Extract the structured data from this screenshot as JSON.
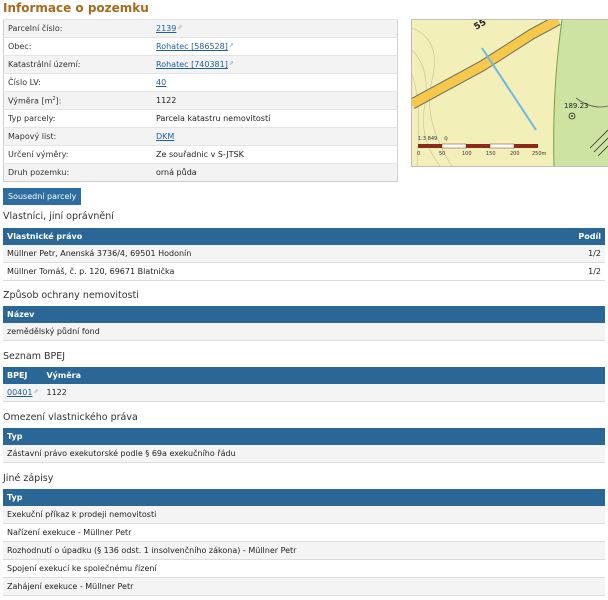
{
  "title": "Informace o pozemku",
  "info_rows": [
    {
      "label": "Parcelní číslo:",
      "value": "2139",
      "link": true
    },
    {
      "label": "Obec:",
      "value": "Rohatec [586528]",
      "link": true
    },
    {
      "label": "Katastrální území:",
      "value": "Rohatec [740381]",
      "link": true
    },
    {
      "label": "Číslo LV:",
      "value": "40",
      "link": true
    },
    {
      "label": "Výměra [m2]:",
      "value": "1122",
      "link": false
    },
    {
      "label": "Typ parcely:",
      "value": "Parcela katastru nemovitostí",
      "link": false
    },
    {
      "label": "Mapový list:",
      "value": "DKM",
      "link": true
    },
    {
      "label": "Určení výměry:",
      "value": "Ze souřadnic v S-JTSK",
      "link": false
    },
    {
      "label": "Druh pozemku:",
      "value": "orná půda",
      "link": false
    }
  ],
  "map": {
    "road_label": "55",
    "elevation_label": "189.23",
    "scale_ratio": "1:3 849",
    "scale_ticks": [
      "0",
      "50",
      "100",
      "150",
      "200",
      "250m"
    ],
    "colors": {
      "field": "#f2f0b8",
      "forest": "#cde3a2",
      "road": "#f6c94a",
      "stream": "#6fb8e0"
    }
  },
  "neighbor_button": "Sousední parcely",
  "owners": {
    "title": "Vlastníci, jiní oprávnění",
    "col1": "Vlastnické právo",
    "col2": "Podíl",
    "rows": [
      {
        "name": "Müllner Petr, Anenská 3736/4, 69501 Hodonín",
        "share": "1/2"
      },
      {
        "name": "Müllner Tomáš, č. p. 120, 69671 Blatnička",
        "share": "1/2"
      }
    ]
  },
  "protection": {
    "title": "Způsob ochrany nemovitosti",
    "col1": "Název",
    "rows": [
      "zemědělský půdní fond"
    ]
  },
  "bpej": {
    "title": "Seznam BPEJ",
    "col1": "BPEJ",
    "col2": "Výměra",
    "rows": [
      {
        "code": "00401",
        "area": "1122"
      }
    ]
  },
  "restrictions": {
    "title": "Omezení vlastnického práva",
    "col1": "Typ",
    "rows": [
      "Zástavní právo exekutorské podle § 69a exekučního řádu"
    ]
  },
  "other": {
    "title": "Jiné zápisy",
    "col1": "Typ",
    "rows": [
      "Exekuční příkaz k prodeji nemovitosti",
      "Nařízení exekuce - Müllner Petr",
      "Rozhodnutí o úpadku (§ 136 odst. 1 insolvenčního zákona) - Müllner Petr",
      "Spojení exekucí ke společnému řízení",
      "Zahájení exekuce - Müllner Petr"
    ]
  }
}
